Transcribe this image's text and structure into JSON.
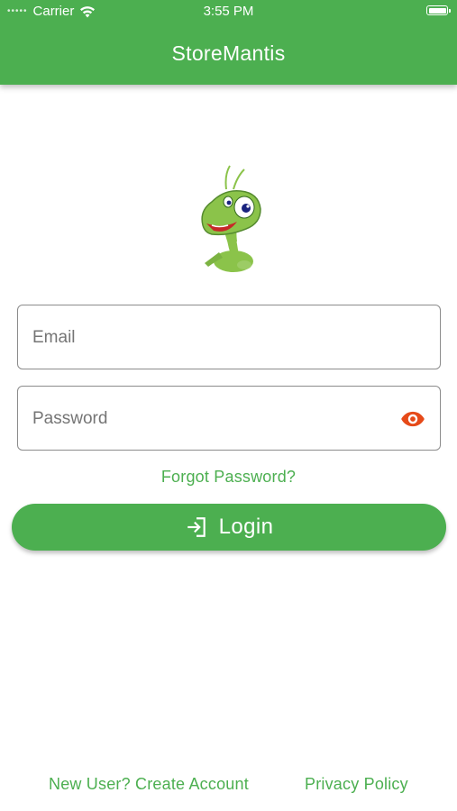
{
  "status_bar": {
    "carrier": "Carrier",
    "time": "3:55 PM"
  },
  "app_bar": {
    "title": "StoreMantis",
    "color": "#4caf50"
  },
  "logo": {
    "icon": "mantis-mascot-logo"
  },
  "form": {
    "email_placeholder": "Email",
    "email_value": "",
    "password_placeholder": "Password",
    "password_value": "",
    "password_toggle_icon": "eye-icon",
    "password_toggle_color": "#e64a19",
    "forgot_password": "Forgot Password?",
    "login_label": "Login",
    "login_icon": "login-icon"
  },
  "footer": {
    "create_account": "New User? Create Account",
    "privacy_policy": "Privacy Policy"
  }
}
